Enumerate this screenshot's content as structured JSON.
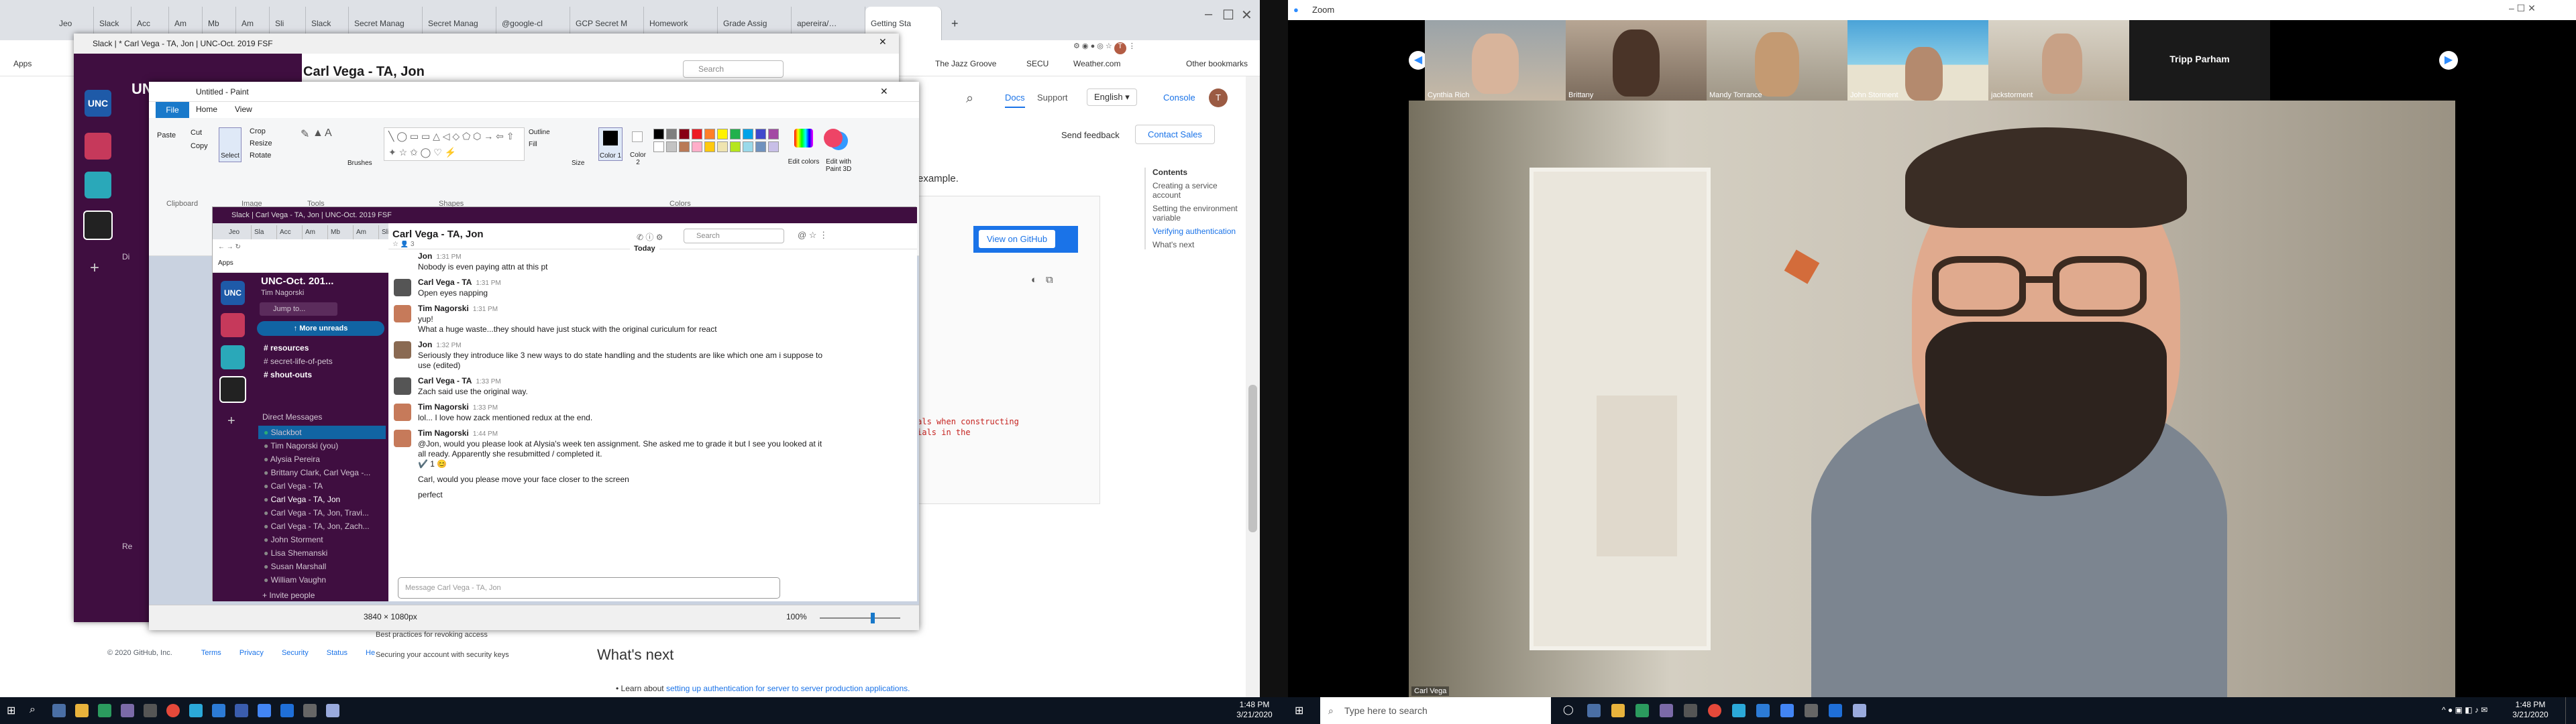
{
  "chrome": {
    "tabs": [
      "Jeo",
      "Slack",
      "Acc",
      "Am",
      "Mb",
      "Am",
      "Sli",
      "Slack",
      "Secret Manag",
      "Secret Manag",
      "@google-cl",
      "GCP Secret M",
      "Homework",
      "Grade Assig",
      "apereira/…",
      "Getting Sta"
    ],
    "address": "",
    "bookmarks": [
      "Apps",
      "The Jazz Groove",
      "SECU",
      "Weather.com",
      "Other bookmarks"
    ],
    "docs_nav": [
      "Docs",
      "Support",
      "English",
      "Console"
    ],
    "send_feedback": "Send feedback",
    "contact_sales": "Contact Sales",
    "view_on_github": "View on GitHub",
    "example_text": "example.",
    "code_lines": [
      "dentials when constructing",
      "edentials in the"
    ],
    "contents_title": "Contents",
    "contents": [
      "Creating a service account",
      "Setting the environment variable",
      "Verifying authentication",
      "What's next"
    ],
    "whats_next_heading": "What's next",
    "learn_about_prefix": "Learn about",
    "learn_about_link": "setting up authentication for server to server production applications.",
    "left_nav": [
      "Best practices for revoking access",
      "Securing your account with security keys"
    ],
    "footer": [
      "© 2020 GitHub, Inc.",
      "Terms",
      "Privacy",
      "Security",
      "Status",
      "He"
    ]
  },
  "slack_big": {
    "window_title": "Slack | * Carl Vega - TA, Jon | UNC-Oct. 2019 FSF",
    "workspace": "UNC-Oct. 201...",
    "channel": "Carl Vega - TA, Jon",
    "search": "Search",
    "side_labels": [
      "Di",
      "Re"
    ]
  },
  "paint": {
    "title": "Untitled - Paint",
    "menu": [
      "File",
      "Home",
      "View"
    ],
    "groups": [
      "Clipboard",
      "Image",
      "Tools",
      "Shapes",
      "Colors"
    ],
    "tools": [
      "Paste",
      "Cut",
      "Copy",
      "Select",
      "Crop",
      "Resize",
      "Rotate",
      "Brushes",
      "Size",
      "Color 1",
      "Color 2",
      "Edit colors",
      "Edit with Paint 3D",
      "Outline",
      "Fill"
    ],
    "size_readout": "3840 × 1080px",
    "zoom": "100%",
    "palette": [
      "#000000",
      "#7f7f7f",
      "#880015",
      "#ed1c24",
      "#ff7f27",
      "#fff200",
      "#22b14c",
      "#00a2e8",
      "#3f48cc",
      "#a349a4",
      "#ffffff",
      "#c3c3c3",
      "#b97a57",
      "#ffaec9",
      "#ffc90e",
      "#efe4b0",
      "#b5e61d",
      "#99d9ea",
      "#7092be",
      "#c8bfe7"
    ]
  },
  "slack_small": {
    "window_title": "Slack | Carl Vega - TA, Jon | UNC-Oct. 2019 FSF",
    "tabs": [
      "Jeo",
      "Sla",
      "Acc",
      "Am",
      "Mb",
      "Am",
      "Sli",
      "Slack",
      "Secret Manag",
      "Secret Manag",
      "@google-cl",
      "GCP Secret M",
      "Homework",
      "Grade Assig"
    ],
    "apps": "Apps",
    "workspace": "UNC-Oct. 201...",
    "user": "Tim Nagorski",
    "jump": "Jump to...",
    "more_unreads": "More unreads",
    "channels": [
      "resources",
      "secret-life-of-pets",
      "shout-outs"
    ],
    "dm_header": "Direct Messages",
    "dms": [
      "Slackbot",
      "Tim Nagorski (you)",
      "Alysia Pereira",
      "Brittany Clark, Carl Vega -...",
      "Carl Vega - TA",
      "Carl Vega - TA, Jon",
      "Carl Vega - TA, Jon, Travi...",
      "Carl Vega - TA, Jon, Zach...",
      "John Storment",
      "Lisa Shemanski",
      "Susan Marshall",
      "William Vaughn"
    ],
    "invite": "Invite people",
    "channel": "Carl Vega - TA, Jon",
    "channel_meta": "☆  👤 3",
    "search": "Search",
    "day": "Today",
    "messages": [
      {
        "name": "Jon",
        "time": "1:31 PM",
        "lines": [
          "Nobody is even paying attn at this pt"
        ],
        "avatar": "none"
      },
      {
        "name": "Carl Vega - TA",
        "time": "1:31 PM",
        "lines": [
          "Open eyes napping"
        ],
        "avatar": "carl"
      },
      {
        "name": "Tim Nagorski",
        "time": "1:31 PM",
        "lines": [
          "yup!",
          "What a huge waste...they should have just stuck with the original curiculum for react"
        ],
        "avatar": "tim"
      },
      {
        "name": "Jon",
        "time": "1:32 PM",
        "lines": [
          "Seriously they introduce like 3 new ways to do state handling and the students are like which one am i suppose to",
          "use (edited)"
        ],
        "avatar": "jon"
      },
      {
        "name": "Carl Vega - TA",
        "time": "1:33 PM",
        "lines": [
          "Zach said use the original way."
        ],
        "avatar": "carl"
      },
      {
        "name": "Tim Nagorski",
        "time": "1:33 PM",
        "lines": [
          "lol... I love how zack mentioned redux at the end."
        ],
        "avatar": "tim"
      },
      {
        "name": "Tim Nagorski",
        "time": "1:44 PM",
        "lines": [
          "@Jon, would you please look at Alysia's week ten assignment. She asked me to grade it but I see you looked at it",
          "all ready. Apparently she resubmitted / completed it.",
          "✔️ 1   😊",
          "Carl, would you please move your face closer to the screen",
          "perfect"
        ],
        "avatar": "tim"
      }
    ],
    "composer_placeholder": "Message Carl Vega - TA, Jon"
  },
  "zoom": {
    "title": "Zoom",
    "participants": [
      "Cynthia Rich",
      "Brittany",
      "Mandy Torrance",
      "John Storment",
      "jackstorment",
      "Tripp Parham"
    ],
    "speaker_label": "Carl Vega"
  },
  "taskbar_left": {
    "time": "1:48 PM",
    "date": "3/21/2020"
  },
  "taskbar_right": {
    "search_placeholder": "Type here to search",
    "time": "1:48 PM",
    "date": "3/21/2020"
  }
}
